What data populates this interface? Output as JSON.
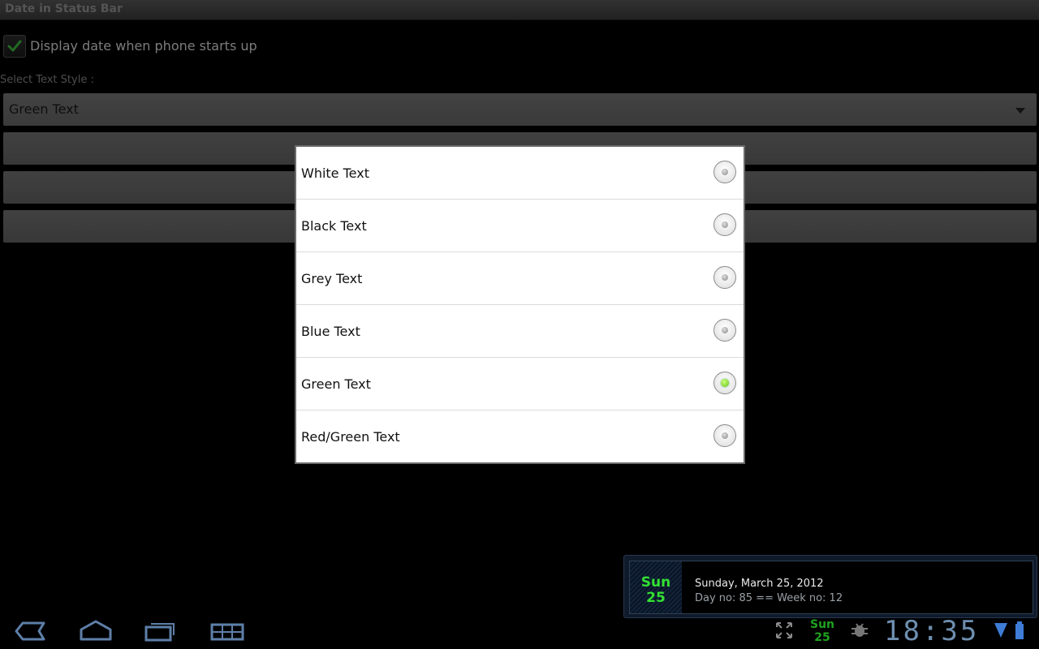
{
  "app": {
    "title": "Date in Status Bar"
  },
  "settings": {
    "checkbox_label": "Display date when phone starts up",
    "checkbox_checked": true,
    "select_label": "Select Text Style :",
    "selected_value": "Green Text"
  },
  "dialog": {
    "options": [
      {
        "label": "White Text",
        "checked": false
      },
      {
        "label": "Black Text",
        "checked": false
      },
      {
        "label": "Grey Text",
        "checked": false
      },
      {
        "label": "Blue Text",
        "checked": false
      },
      {
        "label": "Green Text",
        "checked": true
      },
      {
        "label": "Red/Green Text",
        "checked": false
      }
    ]
  },
  "notification": {
    "icon_day": "Sun",
    "icon_date": "25",
    "title": "Sunday, March 25, 2012",
    "subtitle": "Day no: 85 == Week no: 12"
  },
  "system_bar": {
    "status_day": "Sun",
    "status_date": "25",
    "clock": "18:35",
    "icons": [
      "back-icon",
      "home-icon",
      "recent-apps-icon",
      "menu-grid-icon",
      "expand-icon",
      "debug-icon",
      "wifi-icon",
      "battery-icon"
    ]
  },
  "colors": {
    "accent_green": "#33e033",
    "clock_blue": "#6e8fb0",
    "dialog_bg": "#ffffff"
  }
}
